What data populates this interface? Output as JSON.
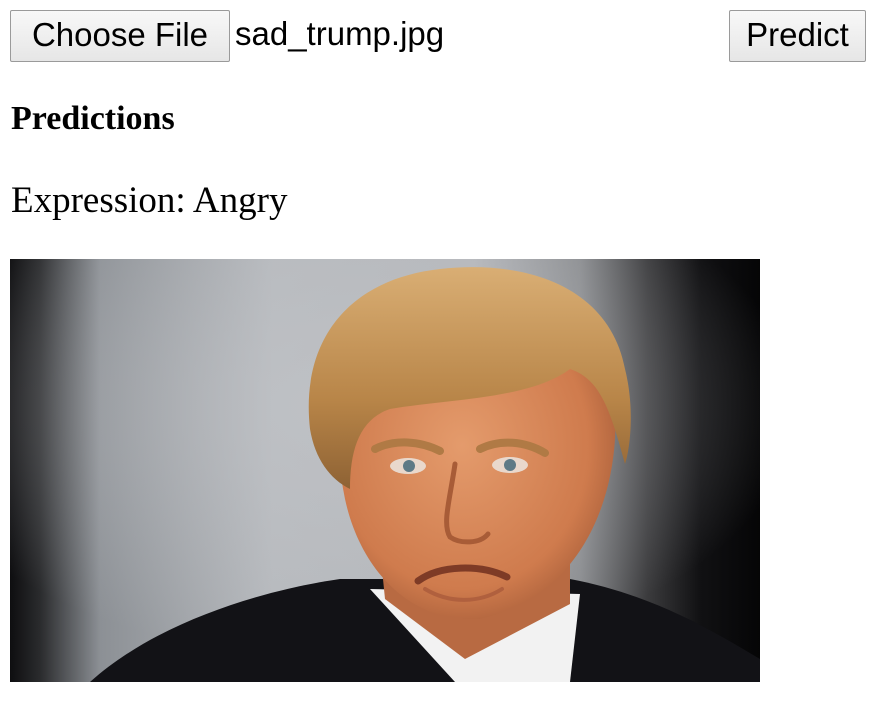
{
  "file_input": {
    "button_label": "Choose File",
    "selected_file": "sad_trump.jpg"
  },
  "predict_button": {
    "label": "Predict"
  },
  "results": {
    "heading": "Predictions",
    "expression_line": "Expression: Angry"
  },
  "image": {
    "description_icon": "uploaded-photo",
    "accent_colors": {
      "hair": "#c7965b",
      "skin": "#d98a5f",
      "suit": "#141418",
      "shirt": "#f2f2f2"
    }
  }
}
